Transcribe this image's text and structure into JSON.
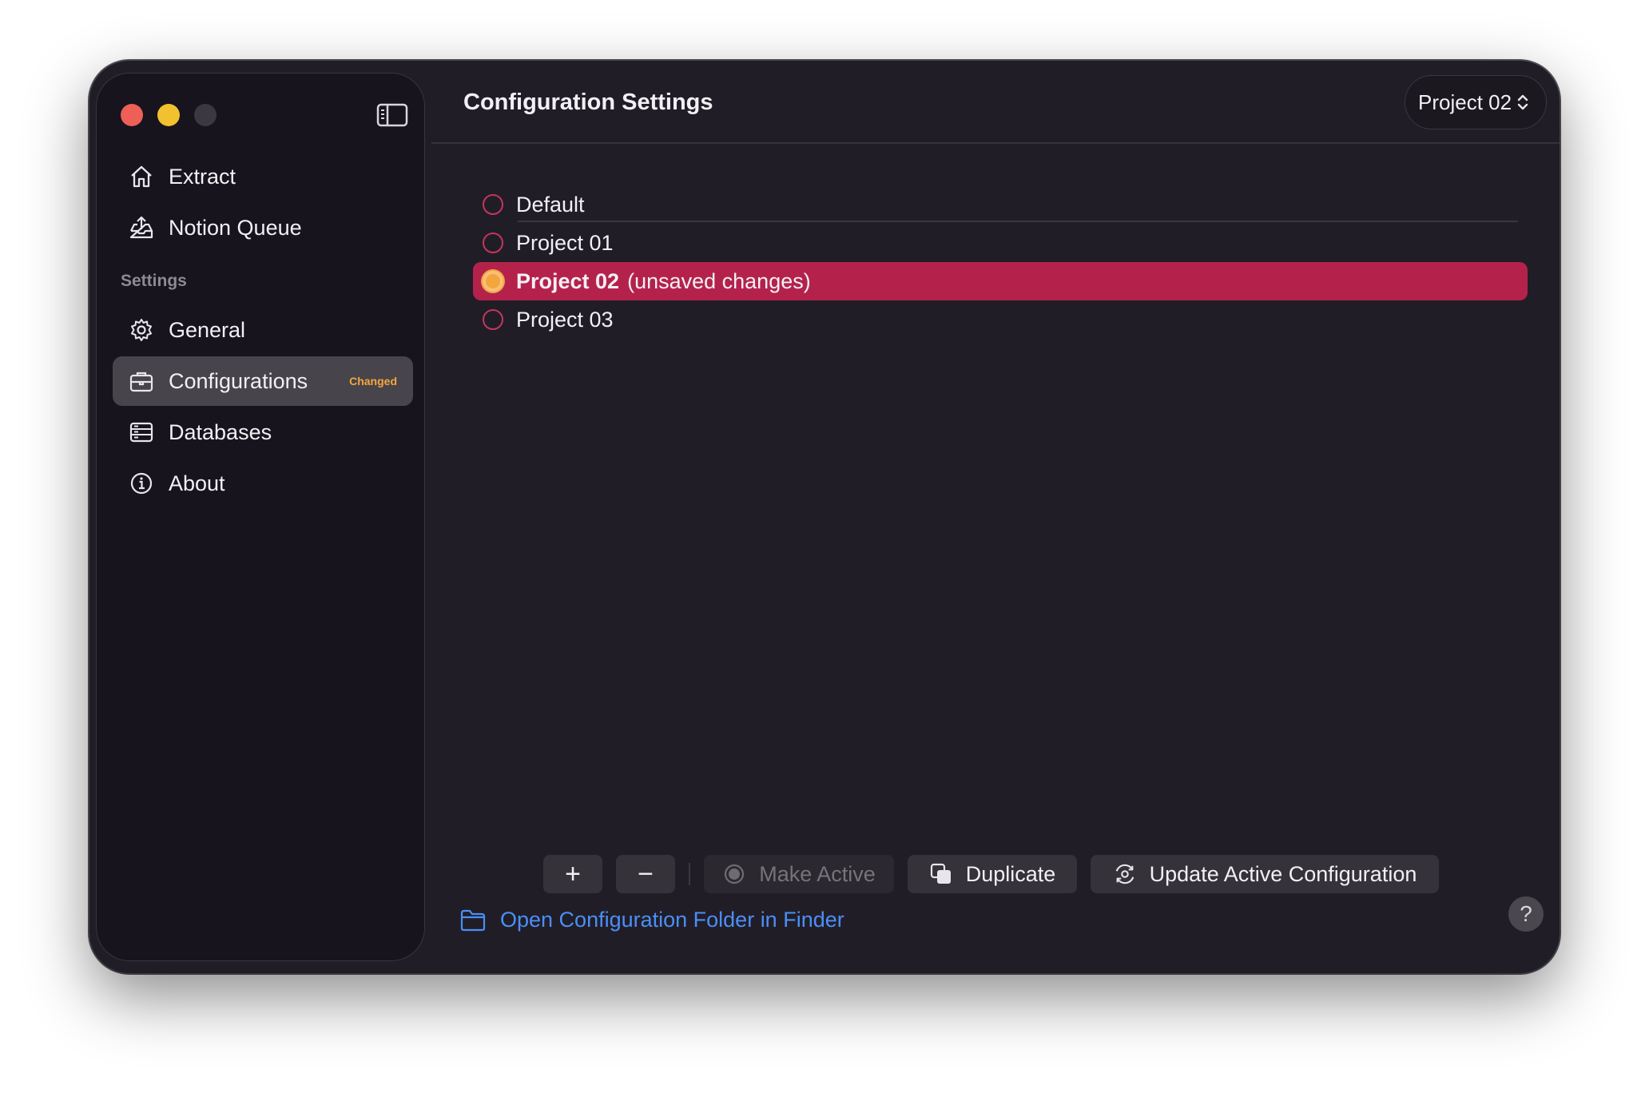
{
  "sidebar": {
    "nav": [
      {
        "label": "Extract",
        "icon": "house-icon"
      },
      {
        "label": "Notion Queue",
        "icon": "tray-upload-icon"
      }
    ],
    "settings_header": "Settings",
    "settings": [
      {
        "label": "General",
        "icon": "gear-icon"
      },
      {
        "label": "Configurations",
        "icon": "briefcase-icon",
        "badge": "Changed",
        "active": true
      },
      {
        "label": "Databases",
        "icon": "database-icon"
      },
      {
        "label": "About",
        "icon": "info-icon"
      }
    ]
  },
  "header": {
    "title": "Configuration Settings",
    "project_selector": "Project 02"
  },
  "configs": [
    {
      "name": "Default"
    },
    {
      "name": "Project 01"
    },
    {
      "name": "Project 02",
      "suffix": "(unsaved changes)",
      "selected": true
    },
    {
      "name": "Project 03"
    }
  ],
  "toolbar": {
    "add": "+",
    "remove": "−",
    "make_active": "Make Active",
    "duplicate": "Duplicate",
    "update": "Update Active Configuration"
  },
  "footer": {
    "open_folder": "Open Configuration Folder in Finder",
    "help": "?"
  },
  "colors": {
    "accent": "#b4224b",
    "radio": "#c2365c",
    "badge": "#f4a63c",
    "link": "#4a8ff7"
  }
}
